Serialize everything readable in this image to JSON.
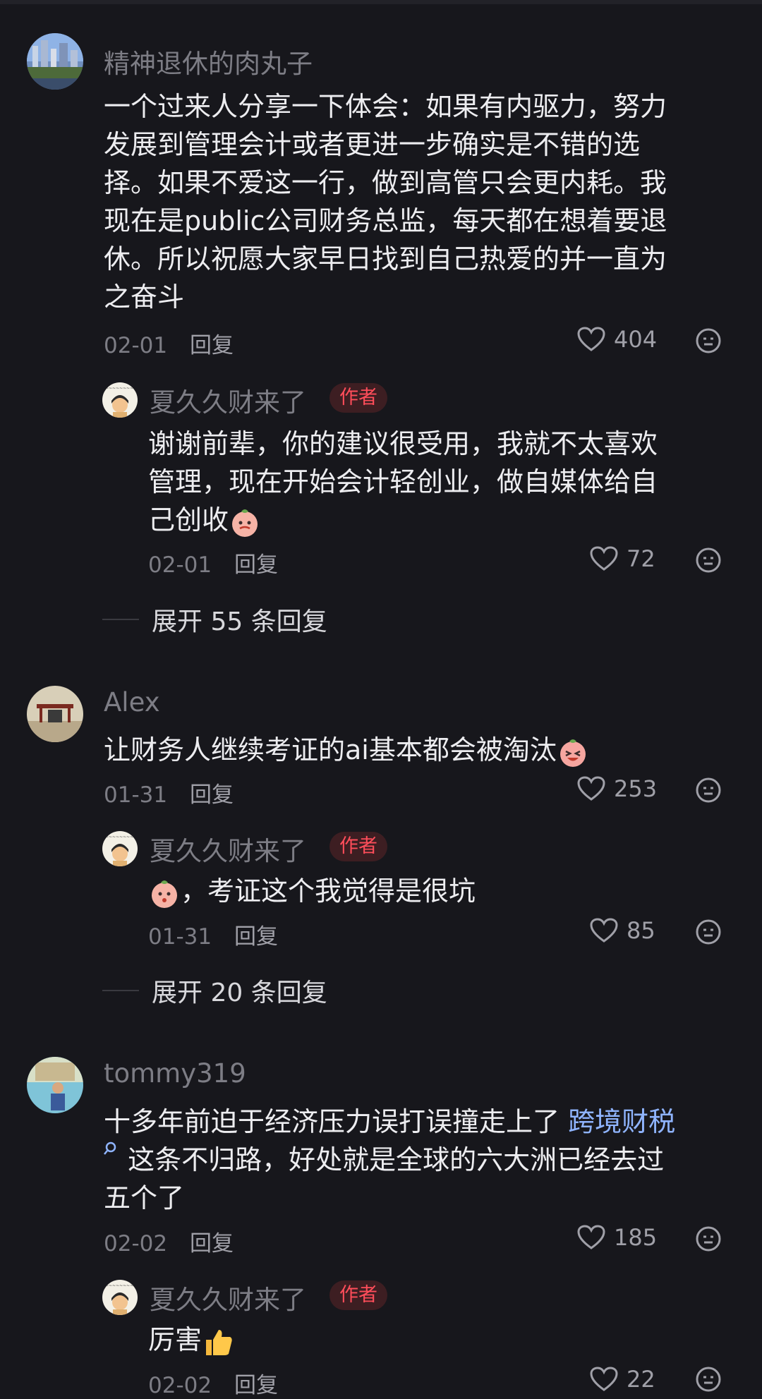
{
  "comments": [
    {
      "username": "精神退休的肉丸子",
      "text_lines": [
        "一个过来人分享一下体会：如果有内驱力，努力",
        "发展到管理会计或者更进一步确实是不错的选",
        "择。如果不爱这一行，做到高管只会更内耗。我",
        "现在是public公司财务总监，每天都在想着要退",
        "休。所以祝愿大家早日找到自己热爱的并一直为",
        "之奋斗"
      ],
      "date": "02-01",
      "reply_label": "回复",
      "likes": "404",
      "reply": {
        "username": "夏久久财来了",
        "badge": "作者",
        "text_lines": [
          "谢谢前辈，你的建议很受用，我就不太喜欢",
          "管理，现在开始会计轻创业，做自媒体给自",
          "己创收"
        ],
        "date": "02-01",
        "reply_label": "回复",
        "likes": "72"
      },
      "expand": "展开 55 条回复"
    },
    {
      "username": "Alex",
      "text_lines": [
        "让财务人继续考证的ai基本都会被淘汰"
      ],
      "date": "01-31",
      "reply_label": "回复",
      "likes": "253",
      "reply": {
        "username": "夏久久财来了",
        "badge": "作者",
        "text_lines": [
          "，考证这个我觉得是很坑"
        ],
        "date": "01-31",
        "reply_label": "回复",
        "likes": "85"
      },
      "expand": "展开 20 条回复"
    },
    {
      "username": "tommy319",
      "text_line1_prefix": "十多年前迫于经济压力误打误撞走上了 ",
      "text_line1_link": "跨境财税",
      "text_line2": " 这条不归路，好处就是全球的六大洲已经去过",
      "text_line3": "五个了",
      "date": "02-02",
      "reply_label": "回复",
      "likes": "185",
      "reply": {
        "username": "夏久久财来了",
        "badge": "作者",
        "text_lines": [
          "厉害"
        ],
        "date": "02-02",
        "reply_label": "回复",
        "likes": "22"
      }
    }
  ],
  "colors": {
    "background": "#17171c",
    "author_badge": "#ff4d5a",
    "link": "#8fb4ff"
  },
  "icons": [
    "heart-outline-icon",
    "emoji-face-icon",
    "search-small-icon",
    "thumbs-up-emoji",
    "peach-emoji"
  ]
}
